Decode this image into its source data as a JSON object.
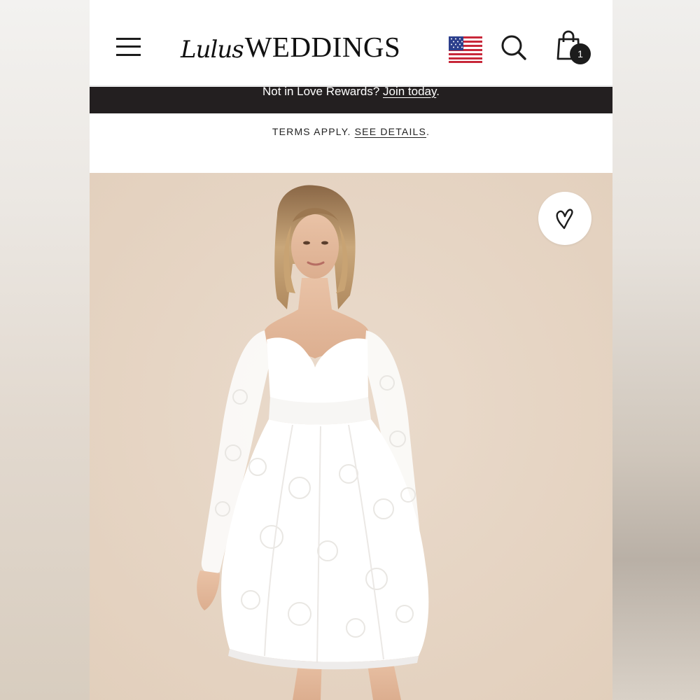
{
  "header": {
    "menu_icon": "hamburger-menu-icon",
    "logo": {
      "script": "Lulus",
      "word": "WEDDINGS"
    },
    "flag_icon": "us-flag-icon",
    "search_icon": "search-icon",
    "cart_icon": "shopping-bag-icon",
    "cart_count": "1"
  },
  "promo": {
    "text": "Not in Love Rewards? ",
    "link": "Join today",
    "suffix": "."
  },
  "terms": {
    "text": "TERMS APPLY. ",
    "link": "SEE DETAILS",
    "suffix": "."
  },
  "product": {
    "favorite_icon": "heart-icon"
  },
  "colors": {
    "promo_bar": "#231f20",
    "image_background": "#e7d5c3",
    "dress": "#ffffff"
  }
}
